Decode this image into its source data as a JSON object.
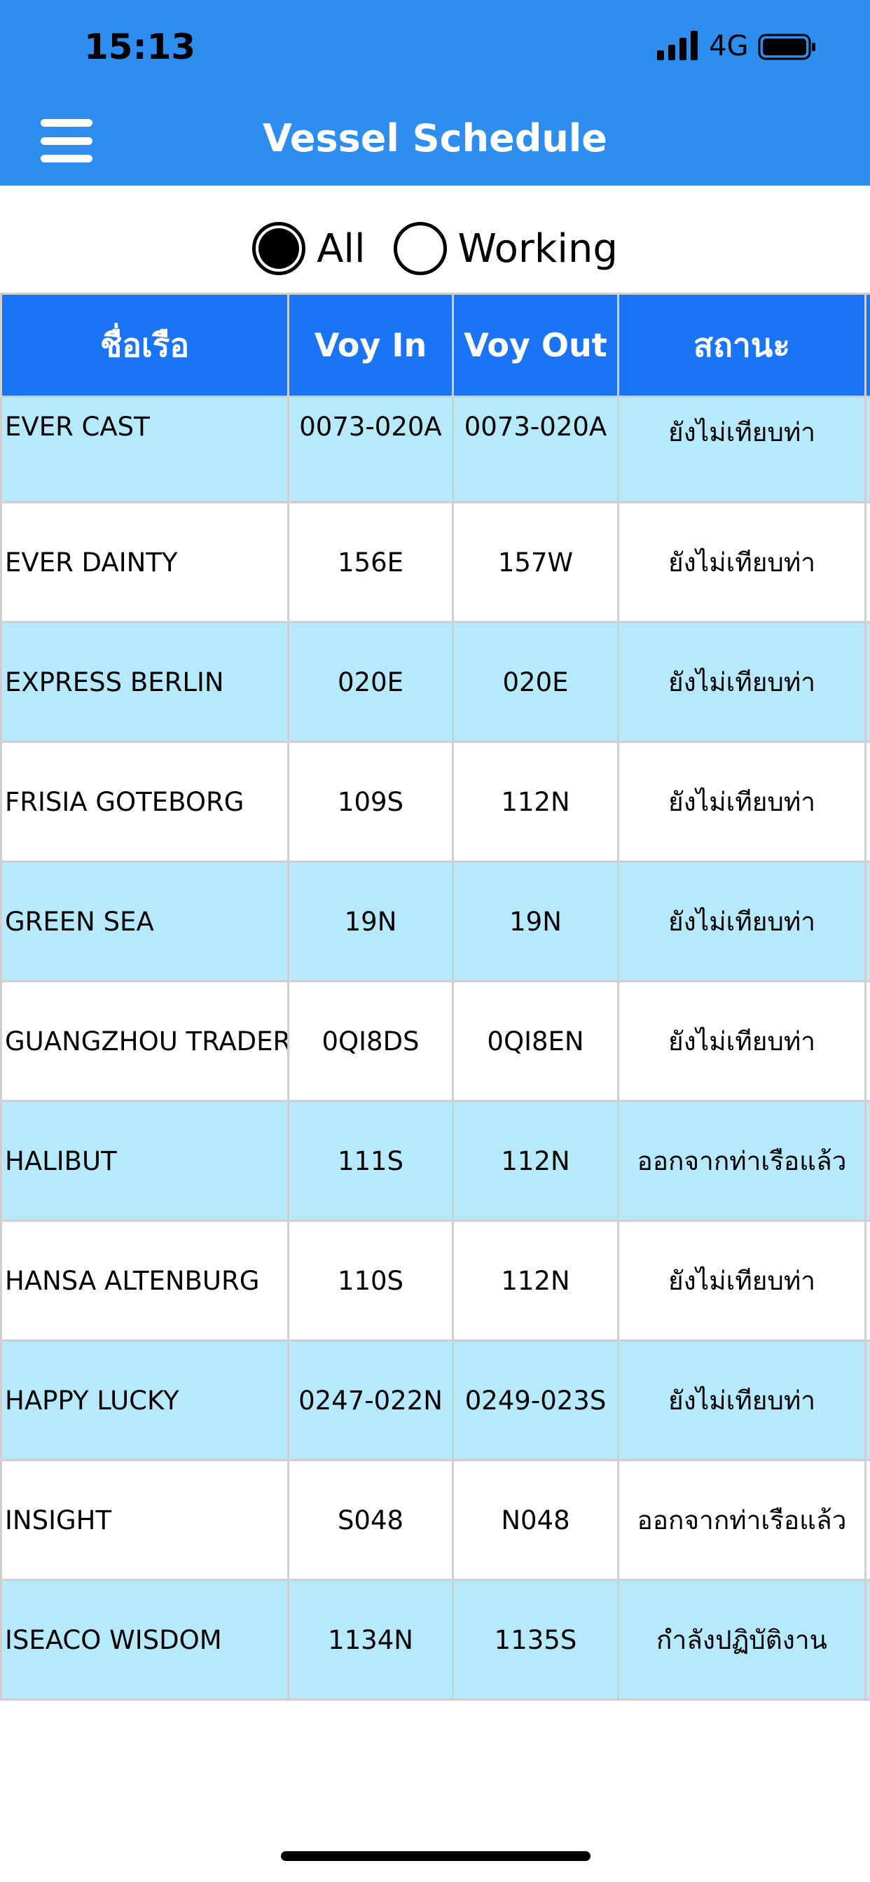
{
  "status_bar": {
    "time": "15:13",
    "network": "4G"
  },
  "header": {
    "title": "Vessel Schedule",
    "menu_icon": "hamburger-menu-icon"
  },
  "filter": {
    "options": [
      {
        "label": "All",
        "selected": true
      },
      {
        "label": "Working",
        "selected": false
      }
    ]
  },
  "table": {
    "headers": [
      "ชื่อเรือ",
      "Voy In",
      "Voy Out",
      "สถานะ"
    ],
    "rows": [
      {
        "vessel": "EVER CAST",
        "voy_in": "0073-020A",
        "voy_out": "0073-020A",
        "status": "ยังไม่เทียบท่า"
      },
      {
        "vessel": "EVER DAINTY",
        "voy_in": "156E",
        "voy_out": "157W",
        "status": "ยังไม่เทียบท่า"
      },
      {
        "vessel": "EXPRESS BERLIN",
        "voy_in": "020E",
        "voy_out": "020E",
        "status": "ยังไม่เทียบท่า"
      },
      {
        "vessel": "FRISIA GOTEBORG",
        "voy_in": "109S",
        "voy_out": "112N",
        "status": "ยังไม่เทียบท่า"
      },
      {
        "vessel": "GREEN SEA",
        "voy_in": "19N",
        "voy_out": "19N",
        "status": "ยังไม่เทียบท่า"
      },
      {
        "vessel": "GUANGZHOU TRADER",
        "voy_in": "0QI8DS",
        "voy_out": "0QI8EN",
        "status": "ยังไม่เทียบท่า"
      },
      {
        "vessel": "HALIBUT",
        "voy_in": "111S",
        "voy_out": "112N",
        "status": "ออกจากท่าเรือแล้ว"
      },
      {
        "vessel": "HANSA ALTENBURG",
        "voy_in": "110S",
        "voy_out": "112N",
        "status": "ยังไม่เทียบท่า"
      },
      {
        "vessel": "HAPPY LUCKY",
        "voy_in": "0247-022N",
        "voy_out": "0249-023S",
        "status": "ยังไม่เทียบท่า"
      },
      {
        "vessel": "INSIGHT",
        "voy_in": "S048",
        "voy_out": "N048",
        "status": "ออกจากท่าเรือแล้ว"
      },
      {
        "vessel": "ISEACO WISDOM",
        "voy_in": "1134N",
        "voy_out": "1135S",
        "status": "กำลังปฏิบัติงาน"
      }
    ]
  },
  "colors": {
    "header_bar": "#2d8ef0",
    "table_header": "#1a74f5",
    "alt_row": "#b6e9fc"
  }
}
